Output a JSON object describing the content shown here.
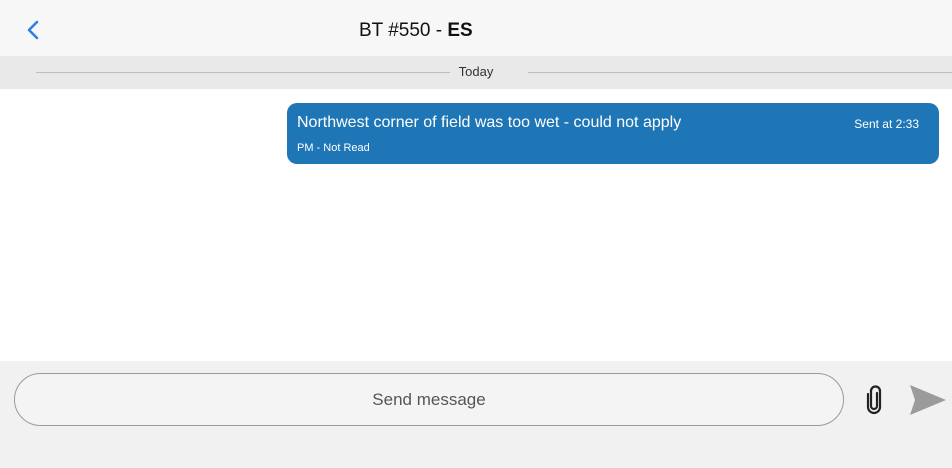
{
  "header": {
    "title_regular": "BT #550 - ",
    "title_bold": "ES",
    "back_icon": "chevron-left-icon",
    "back_color": "#2f7fe0"
  },
  "date_divider": {
    "label": "Today"
  },
  "messages": [
    {
      "text": "Northwest corner of field was too wet - could not apply",
      "status_line1": "Sent at 2:33",
      "status_line2": "PM - Not Read",
      "bubble_color": "#1f76b6",
      "direction": "outgoing"
    }
  ],
  "composer": {
    "placeholder": "Send message",
    "value": "",
    "attach_icon": "paperclip-icon",
    "send_icon": "send-icon"
  }
}
